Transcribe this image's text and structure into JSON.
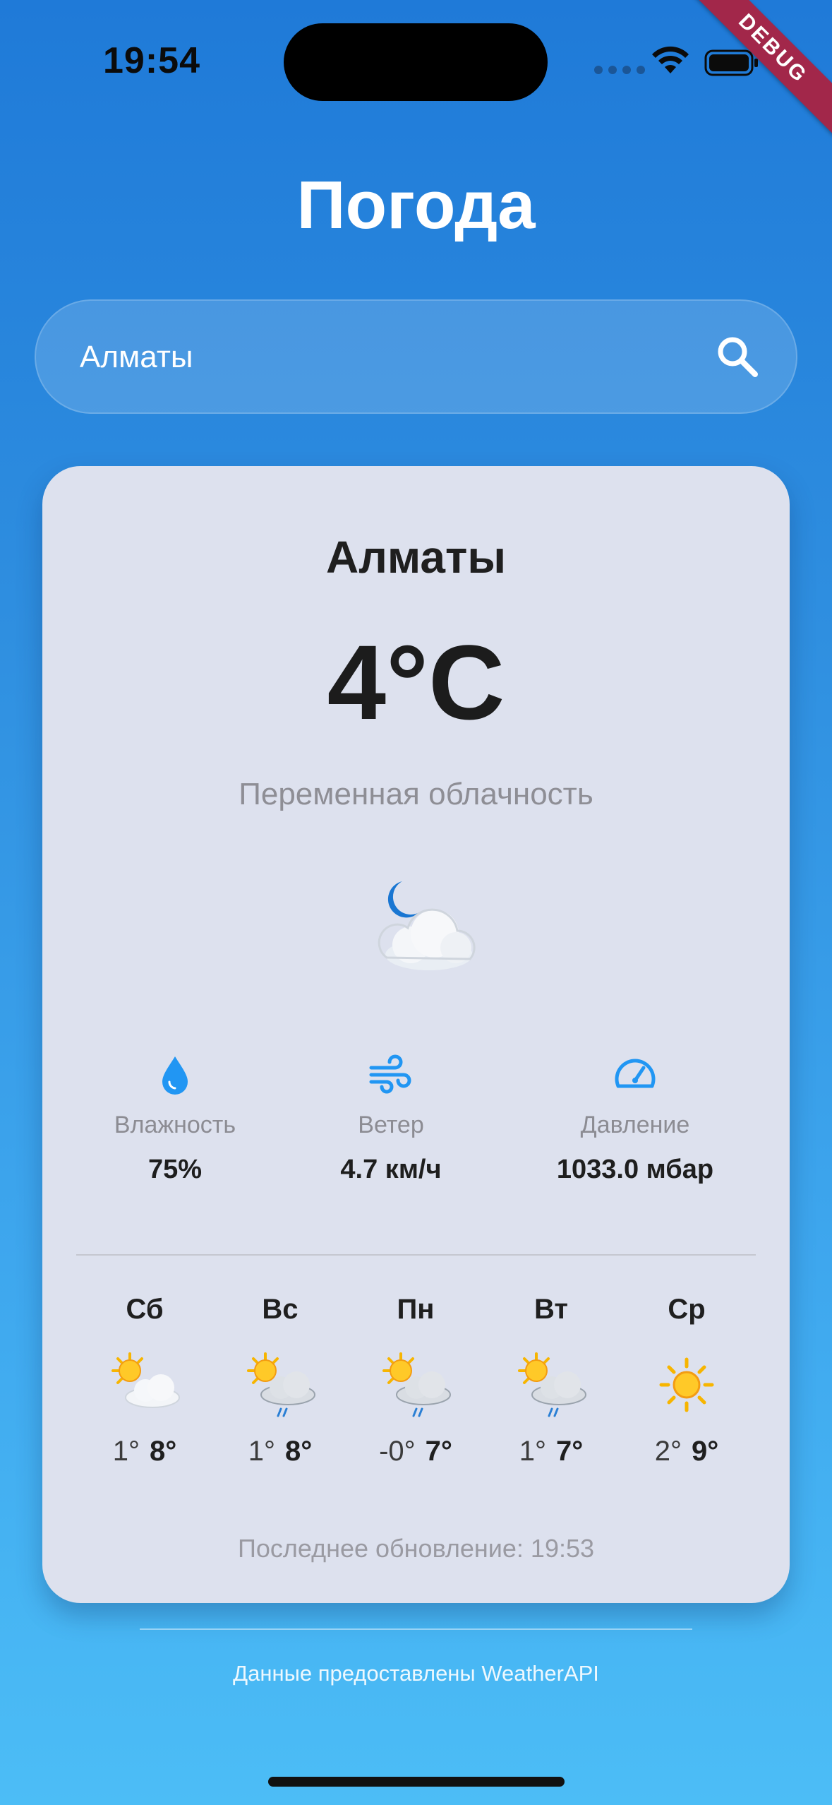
{
  "status_bar": {
    "time": "19:54",
    "debug_label": "DEBUG"
  },
  "header": {
    "title": "Погода"
  },
  "search": {
    "value": "Алматы",
    "placeholder": "",
    "icon": "search-icon"
  },
  "current": {
    "city": "Алматы",
    "temperature": "4°C",
    "condition": "Переменная облачность",
    "icon": "moon-cloud-icon"
  },
  "stats": {
    "humidity": {
      "label": "Влажность",
      "value": "75%",
      "icon": "droplet-icon"
    },
    "wind": {
      "label": "Ветер",
      "value": "4.7 км/ч",
      "icon": "wind-icon"
    },
    "pressure": {
      "label": "Давление",
      "value": "1033.0 мбар",
      "icon": "gauge-icon"
    }
  },
  "forecast": [
    {
      "day": "Сб",
      "min": "1°",
      "max": "8°",
      "icon": "sun-cloud-icon"
    },
    {
      "day": "Вс",
      "min": "1°",
      "max": "8°",
      "icon": "sun-cloud-rain-icon"
    },
    {
      "day": "Пн",
      "min": "-0°",
      "max": "7°",
      "icon": "sun-cloud-rain-icon"
    },
    {
      "day": "Вт",
      "min": "1°",
      "max": "7°",
      "icon": "sun-cloud-rain-icon"
    },
    {
      "day": "Ср",
      "min": "2°",
      "max": "9°",
      "icon": "sun-icon"
    }
  ],
  "last_update": "Последнее обновление: 19:53",
  "footer": {
    "attribution": "Данные предоставлены WeatherAPI"
  },
  "colors": {
    "accent_blue": "#2196f3",
    "card_bg": "#dde1ee",
    "gradient_top": "#1f7ad8",
    "gradient_bottom": "#4cbdf6"
  }
}
